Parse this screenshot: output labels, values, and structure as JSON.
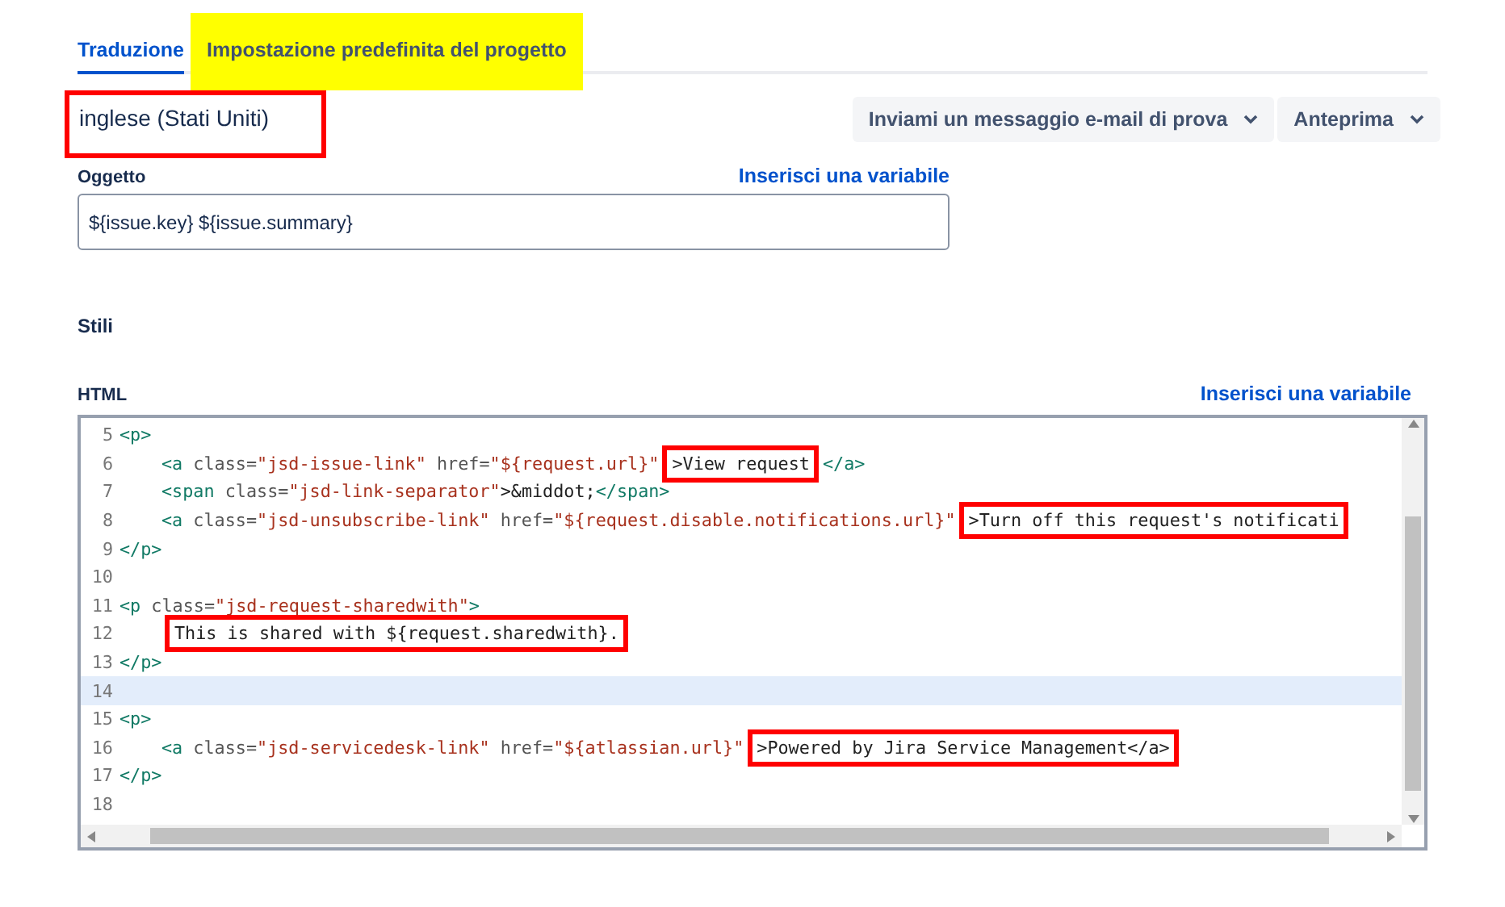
{
  "tabs": [
    {
      "label": "Traduzione",
      "selected": true,
      "highlighted": false
    },
    {
      "label": "Impostazione predefinita del progetto",
      "selected": false,
      "highlighted": true
    }
  ],
  "language": {
    "label": "inglese (Stati Uniti)",
    "boxed": true
  },
  "actions": [
    {
      "label": "Inviami un messaggio e-mail di prova"
    },
    {
      "label": "Anteprima"
    }
  ],
  "subject": {
    "label": "Oggetto",
    "insert_link": "Inserisci una variabile",
    "value": "${issue.key} ${issue.summary}"
  },
  "styles_heading": "Stili",
  "html": {
    "label": "HTML",
    "insert_link": "Inserisci una variabile",
    "lines": [
      {
        "number": "5",
        "active": false,
        "indent": false,
        "tokens": [
          {
            "kind": "tag",
            "text": "<p>",
            "boxed": false
          }
        ]
      },
      {
        "number": "6",
        "active": false,
        "indent": true,
        "tokens": [
          {
            "kind": "tag",
            "text": "<a ",
            "boxed": false
          },
          {
            "kind": "attr",
            "text": "class=",
            "boxed": false
          },
          {
            "kind": "string",
            "text": "\"jsd-issue-link\"",
            "boxed": false
          },
          {
            "kind": "attr",
            "text": " href=",
            "boxed": false
          },
          {
            "kind": "string",
            "text": "\"${request.url}\"",
            "boxed": false
          },
          {
            "kind": "plain",
            "text": ">View request",
            "boxed": true
          },
          {
            "kind": "tag",
            "text": "</a>",
            "boxed": false
          }
        ]
      },
      {
        "number": "7",
        "active": false,
        "indent": true,
        "tokens": [
          {
            "kind": "tag",
            "text": "<span ",
            "boxed": false
          },
          {
            "kind": "attr",
            "text": "class=",
            "boxed": false
          },
          {
            "kind": "string",
            "text": "\"jsd-link-separator\"",
            "boxed": false
          },
          {
            "kind": "plain",
            "text": ">&middot;",
            "boxed": false
          },
          {
            "kind": "tag",
            "text": "</span>",
            "boxed": false
          }
        ]
      },
      {
        "number": "8",
        "active": false,
        "indent": true,
        "tokens": [
          {
            "kind": "tag",
            "text": "<a ",
            "boxed": false
          },
          {
            "kind": "attr",
            "text": "class=",
            "boxed": false
          },
          {
            "kind": "string",
            "text": "\"jsd-unsubscribe-link\"",
            "boxed": false
          },
          {
            "kind": "attr",
            "text": " href=",
            "boxed": false
          },
          {
            "kind": "string",
            "text": "\"${request.disable.notifications.url}\"",
            "boxed": false
          },
          {
            "kind": "plain",
            "text": ">Turn off this request's notificati",
            "boxed": true
          }
        ]
      },
      {
        "number": "9",
        "active": false,
        "indent": false,
        "tokens": [
          {
            "kind": "tag",
            "text": "</p>",
            "boxed": false
          }
        ]
      },
      {
        "number": "10",
        "active": false
      },
      {
        "number": "11",
        "active": false,
        "indent": false,
        "tokens": [
          {
            "kind": "tag",
            "text": "<p ",
            "boxed": false
          },
          {
            "kind": "attr",
            "text": "class=",
            "boxed": false
          },
          {
            "kind": "string",
            "text": "\"jsd-request-sharedwith\"",
            "boxed": false
          },
          {
            "kind": "tag",
            "text": ">",
            "boxed": false
          }
        ]
      },
      {
        "number": "12",
        "active": false,
        "indent": true,
        "tokens": [
          {
            "kind": "plain",
            "text": "This is shared with ${request.sharedwith}.",
            "boxed": true
          }
        ]
      },
      {
        "number": "13",
        "active": false,
        "indent": false,
        "tokens": [
          {
            "kind": "tag",
            "text": "</p>",
            "boxed": false
          }
        ]
      },
      {
        "number": "14",
        "active": true
      },
      {
        "number": "15",
        "active": false,
        "indent": false,
        "tokens": [
          {
            "kind": "tag",
            "text": "<p>",
            "boxed": false
          }
        ]
      },
      {
        "number": "16",
        "active": false,
        "indent": true,
        "tokens": [
          {
            "kind": "tag",
            "text": "<a ",
            "boxed": false
          },
          {
            "kind": "attr",
            "text": "class=",
            "boxed": false
          },
          {
            "kind": "string",
            "text": "\"jsd-servicedesk-link\"",
            "boxed": false
          },
          {
            "kind": "attr",
            "text": " href=",
            "boxed": false
          },
          {
            "kind": "string",
            "text": "\"${atlassian.url}\"",
            "boxed": false
          },
          {
            "kind": "plain",
            "text": ">Powered by Jira Service Management</a>",
            "boxed": true
          }
        ]
      },
      {
        "number": "17",
        "active": false,
        "indent": false,
        "tokens": [
          {
            "kind": "tag",
            "text": "</p>",
            "boxed": false
          }
        ]
      },
      {
        "number": "18",
        "active": false
      }
    ]
  }
}
